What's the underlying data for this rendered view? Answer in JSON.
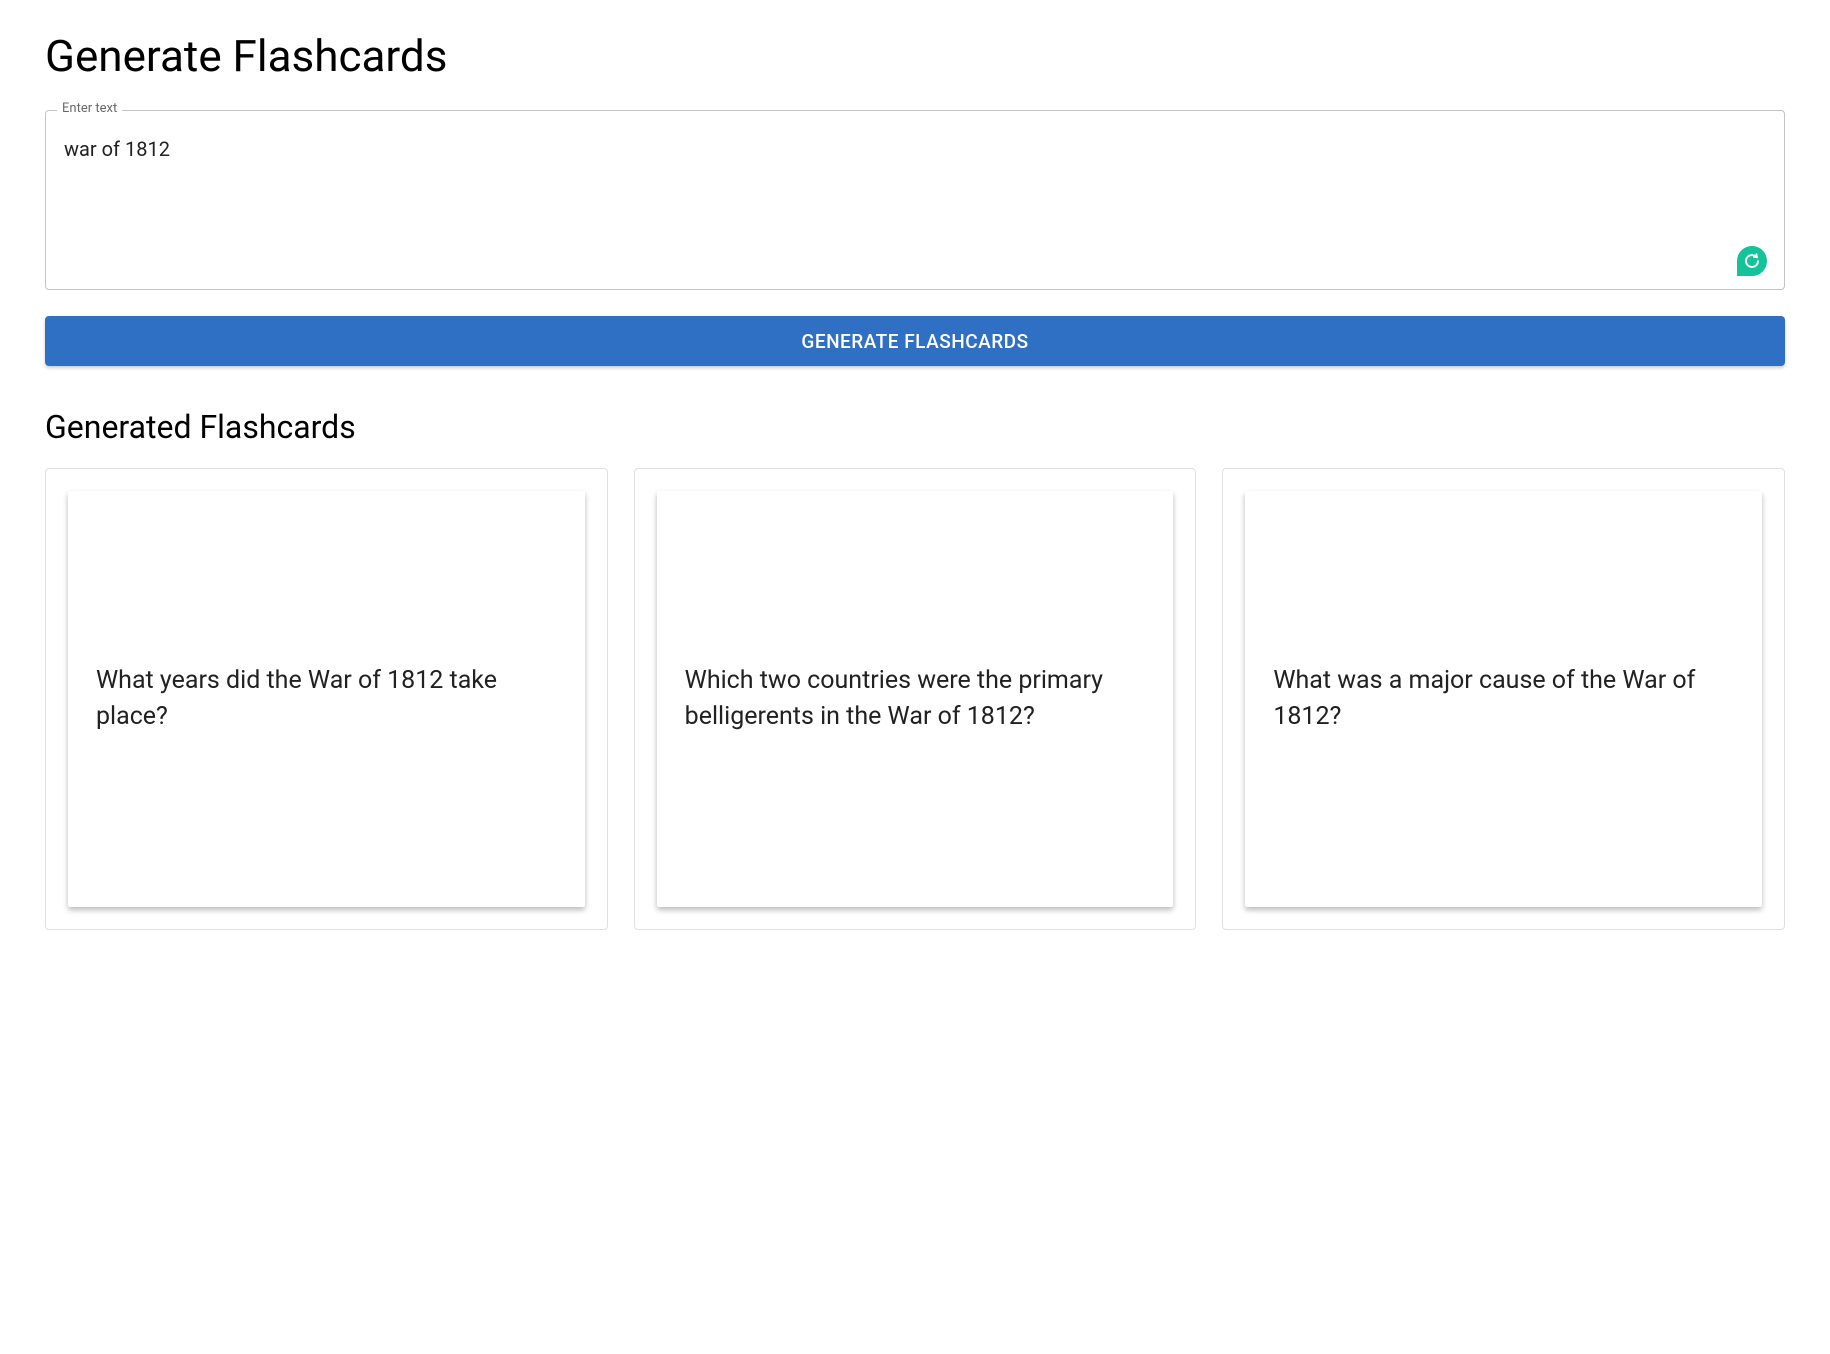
{
  "header": {
    "title": "Generate Flashcards"
  },
  "input": {
    "label": "Enter text",
    "value": "war of 1812"
  },
  "actions": {
    "generate_label": "Generate Flashcards"
  },
  "results": {
    "title": "Generated Flashcards",
    "cards": [
      {
        "question": "What years did the War of 1812 take place?"
      },
      {
        "question": "Which two countries were the primary belligerents in the War of 1812?"
      },
      {
        "question": "What was a major cause of the War of 1812?"
      }
    ]
  },
  "colors": {
    "primary": "#2f6fc4",
    "grammarly": "#15c39a"
  }
}
